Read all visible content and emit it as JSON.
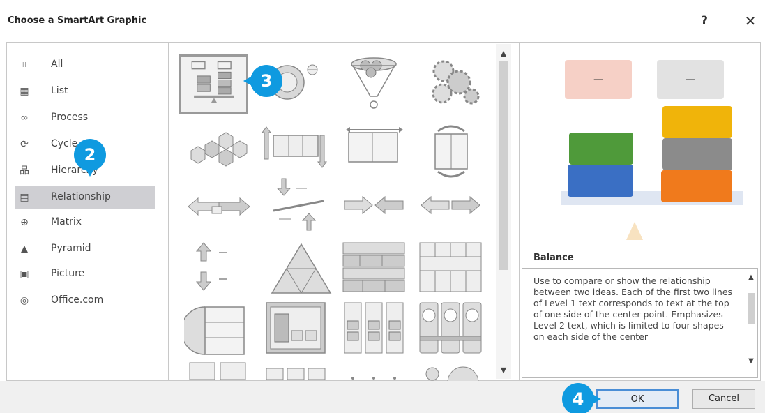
{
  "dialog": {
    "title": "Choose a SmartArt Graphic",
    "help_label": "?",
    "close_label": "✕"
  },
  "categories": [
    {
      "label": "All",
      "icon": "all-icon",
      "glyph": "⌗",
      "selected": false
    },
    {
      "label": "List",
      "icon": "list-icon",
      "glyph": "▦",
      "selected": false
    },
    {
      "label": "Process",
      "icon": "process-icon",
      "glyph": "∞",
      "selected": false
    },
    {
      "label": "Cycle",
      "icon": "cycle-icon",
      "glyph": "⟳",
      "selected": false
    },
    {
      "label": "Hierarchy",
      "icon": "hierarchy-icon",
      "glyph": "品",
      "selected": false
    },
    {
      "label": "Relationship",
      "icon": "relationship-icon",
      "glyph": "▤",
      "selected": true
    },
    {
      "label": "Matrix",
      "icon": "matrix-icon",
      "glyph": "⊕",
      "selected": false
    },
    {
      "label": "Pyramid",
      "icon": "pyramid-icon",
      "glyph": "▲",
      "selected": false
    },
    {
      "label": "Picture",
      "icon": "picture-icon",
      "glyph": "▣",
      "selected": false
    },
    {
      "label": "Office.com",
      "icon": "office-com-icon",
      "glyph": "◎",
      "selected": false
    }
  ],
  "gallery": {
    "scroll_up": "▲",
    "scroll_down": "▼",
    "selected_layout": "Balance"
  },
  "preview": {
    "name": "Balance",
    "description": "Use to compare or show the relationship between two ideas. Each of the first two lines of Level 1 text corresponds to text at the top of one side of the center point. Emphasizes Level 2 text, which is limited to four shapes on each side of the center",
    "scroll_up": "▲",
    "scroll_down": "▼",
    "top_box_label": "—",
    "colors": {
      "left_top": "#f6d0c6",
      "right_top": "#e2e2e2",
      "green": "#4f9a3a",
      "blue": "#3a6fc4",
      "yellow": "#f0b40a",
      "gray": "#8b8b8b",
      "orange": "#f07a1c",
      "beam": "#dfe6f2",
      "fulcrum": "#f8e2c0"
    }
  },
  "buttons": {
    "ok": "OK",
    "cancel": "Cancel"
  },
  "callouts": {
    "two": "2",
    "three": "3",
    "four": "4",
    "color": "#0f9ae0"
  }
}
